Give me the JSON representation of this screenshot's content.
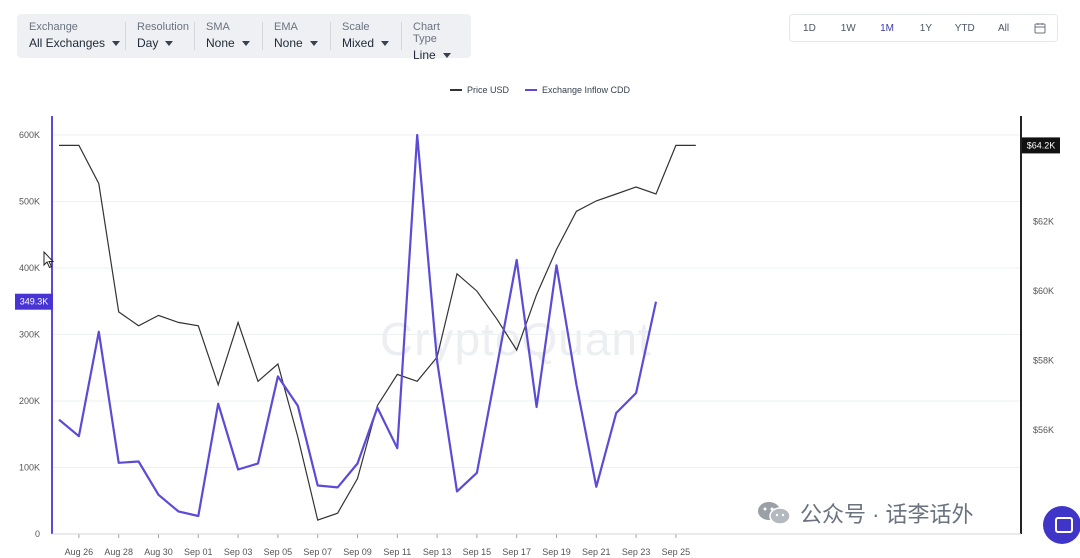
{
  "toolbar": {
    "exchange": {
      "label": "Exchange",
      "value": "All Exchanges"
    },
    "resolution": {
      "label": "Resolution",
      "value": "Day"
    },
    "sma": {
      "label": "SMA",
      "value": "None"
    },
    "ema": {
      "label": "EMA",
      "value": "None"
    },
    "scale": {
      "label": "Scale",
      "value": "Mixed"
    },
    "chart_type": {
      "label": "Chart Type",
      "value": "Line"
    }
  },
  "ranges": [
    "1D",
    "1W",
    "1M",
    "1Y",
    "YTD",
    "All"
  ],
  "active_range": "1M",
  "watermark": "CryptoQuant",
  "footer_watermark": "公众号 · 话李话外",
  "colors": {
    "price": "#333333",
    "inflow": "#5b4bd6",
    "accent": "#4834d4",
    "badge_dark": "#111111"
  },
  "chart_data": {
    "type": "line",
    "x": [
      "Aug 25",
      "Aug 26",
      "Aug 27",
      "Aug 28",
      "Aug 29",
      "Aug 30",
      "Aug 31",
      "Sep 01",
      "Sep 02",
      "Sep 03",
      "Sep 04",
      "Sep 05",
      "Sep 06",
      "Sep 07",
      "Sep 08",
      "Sep 09",
      "Sep 10",
      "Sep 11",
      "Sep 12",
      "Sep 13",
      "Sep 14",
      "Sep 15",
      "Sep 16",
      "Sep 17",
      "Sep 18",
      "Sep 19",
      "Sep 20",
      "Sep 21",
      "Sep 22",
      "Sep 23",
      "Sep 24",
      "Sep 25"
    ],
    "x_tick_labels": [
      "Aug 26",
      "Aug 28",
      "Aug 30",
      "Sep 01",
      "Sep 03",
      "Sep 05",
      "Sep 07",
      "Sep 09",
      "Sep 11",
      "Sep 13",
      "Sep 15",
      "Sep 17",
      "Sep 19",
      "Sep 21",
      "Sep 23",
      "Sep 25"
    ],
    "series": [
      {
        "name": "Exchange Inflow CDD",
        "axis": "left",
        "values": [
          172000,
          147000,
          304000,
          107000,
          109000,
          59000,
          34000,
          27000,
          196000,
          97000,
          106000,
          237000,
          193000,
          73000,
          70000,
          106000,
          190000,
          129000,
          600000,
          260000,
          64000,
          92000,
          251000,
          412000,
          191000,
          404000,
          225000,
          71000,
          182000,
          212000,
          349300
        ]
      },
      {
        "name": "Price USD",
        "axis": "right",
        "values": [
          64200,
          64200,
          63100,
          59400,
          59000,
          59300,
          59100,
          59000,
          57300,
          59100,
          57400,
          57900,
          55800,
          53400,
          53600,
          54600,
          56700,
          57600,
          57400,
          58100,
          60500,
          60000,
          59200,
          58300,
          59900,
          61200,
          62300,
          62600,
          62800,
          63000,
          62800,
          64200,
          64200
        ]
      }
    ],
    "yaxis_left": {
      "ticks": [
        "0",
        "100K",
        "200K",
        "300K",
        "400K",
        "500K",
        "600K"
      ],
      "min": 0,
      "max": 600000,
      "current_label": "349.3K"
    },
    "yaxis_right": {
      "ticks": [
        "$56K",
        "$58K",
        "$60K",
        "$62K"
      ],
      "min": 53000,
      "max": 64500,
      "current_label": "$64.2K"
    },
    "legend": [
      "Price USD",
      "Exchange Inflow CDD"
    ],
    "legend_position": "top-center",
    "grid": true
  }
}
